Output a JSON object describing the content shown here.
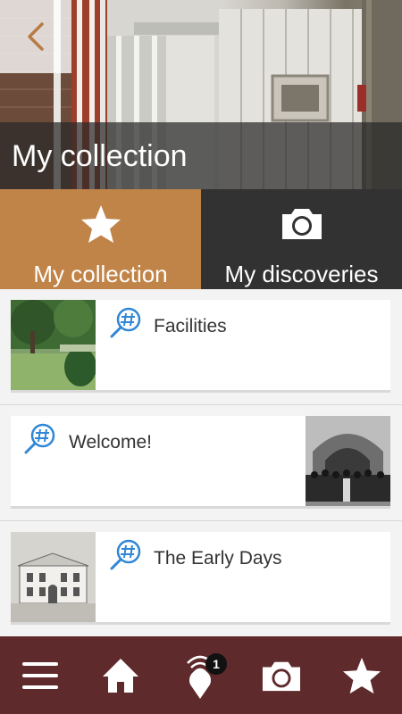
{
  "header": {
    "title": "My collection",
    "back_icon": "chevron-left-icon"
  },
  "tabs": [
    {
      "label": "My collection",
      "icon": "star-icon",
      "active": true
    },
    {
      "label": "My discoveries",
      "icon": "camera-icon",
      "active": false
    }
  ],
  "items": [
    {
      "title": "Facilities",
      "icon": "hashtag-search-icon",
      "image": "garden-trees-photo",
      "image_side": "left"
    },
    {
      "title": "Welcome!",
      "icon": "hashtag-search-icon",
      "image": "group-of-guards-photo",
      "image_side": "right"
    },
    {
      "title": "The Early Days",
      "icon": "hashtag-search-icon",
      "image": "historic-building-sketch",
      "image_side": "left"
    }
  ],
  "bottom_nav": {
    "items": [
      "menu-icon",
      "home-icon",
      "location-beacon-icon",
      "camera-icon",
      "star-icon"
    ],
    "badge_count": "1"
  },
  "colors": {
    "active_tab": "#c18448",
    "inactive_tab": "#323232",
    "bottom_nav": "#5f2a2b",
    "accent_icon": "#2f87d6"
  }
}
